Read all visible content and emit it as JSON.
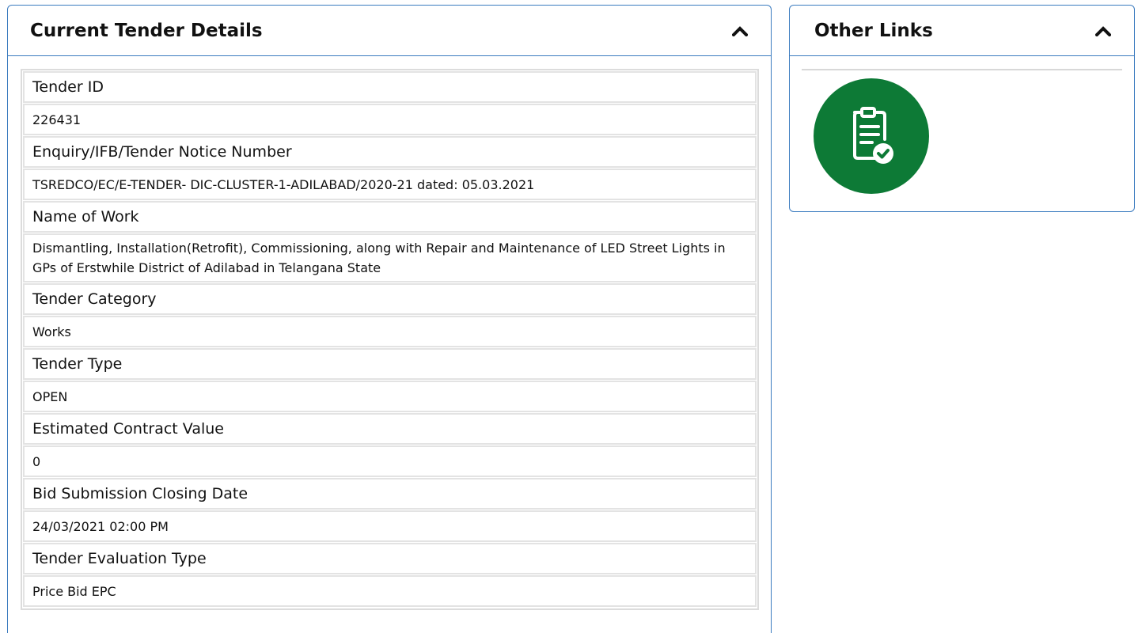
{
  "tender_panel": {
    "title": "Current Tender Details",
    "rows": [
      {
        "label": "Tender ID",
        "value": "226431"
      },
      {
        "label": "Enquiry/IFB/Tender Notice Number",
        "value": "TSREDCO/EC/E-TENDER- DIC-CLUSTER-1-ADILABAD/2020-21 dated: 05.03.2021"
      },
      {
        "label": "Name of Work",
        "value": "Dismantling, Installation(Retrofit), Commissioning, along with Repair and Maintenance of LED Street Lights in GPs of Erstwhile District of Adilabad in Telangana State"
      },
      {
        "label": "Tender Category",
        "value": "Works"
      },
      {
        "label": "Tender Type",
        "value": "OPEN"
      },
      {
        "label": "Estimated Contract Value",
        "value": "0"
      },
      {
        "label": "Bid Submission Closing Date",
        "value": "24/03/2021 02:00 PM"
      },
      {
        "label": "Tender Evaluation Type",
        "value": "Price Bid EPC"
      }
    ]
  },
  "links_panel": {
    "title": "Other Links",
    "link_icon": "clipboard-check-icon"
  },
  "colors": {
    "panel_border": "#3b7bbf",
    "row_border": "#e3e3e3",
    "icon_circle": "#0d7a36"
  }
}
